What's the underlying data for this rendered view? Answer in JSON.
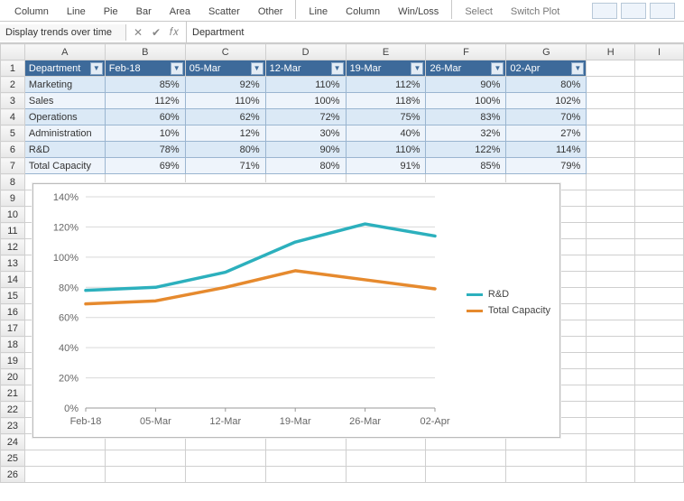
{
  "ribbon": {
    "items": [
      "Column",
      "Line",
      "Pie",
      "Bar",
      "Area",
      "Scatter",
      "Other"
    ],
    "spark": [
      "Line",
      "Column",
      "Win/Loss"
    ],
    "select": "Select",
    "switch": "Switch Plot"
  },
  "namebox": {
    "text": "Display trends over time"
  },
  "formula_label": "𝑓𝑥",
  "formula": "Department",
  "columns": [
    "A",
    "B",
    "C",
    "D",
    "E",
    "F",
    "G",
    "H",
    "I"
  ],
  "rows_shown": 26,
  "table": {
    "headers": [
      "Department",
      "Feb-18",
      "05-Mar",
      "12-Mar",
      "19-Mar",
      "26-Mar",
      "02-Apr"
    ],
    "rows": [
      {
        "dept": "Marketing",
        "vals": [
          "85%",
          "92%",
          "110%",
          "112%",
          "90%",
          "80%"
        ]
      },
      {
        "dept": "Sales",
        "vals": [
          "112%",
          "110%",
          "100%",
          "118%",
          "100%",
          "102%"
        ]
      },
      {
        "dept": "Operations",
        "vals": [
          "60%",
          "62%",
          "72%",
          "75%",
          "83%",
          "70%"
        ]
      },
      {
        "dept": "Administration",
        "vals": [
          "10%",
          "12%",
          "30%",
          "40%",
          "32%",
          "27%"
        ]
      },
      {
        "dept": "R&D",
        "vals": [
          "78%",
          "80%",
          "90%",
          "110%",
          "122%",
          "114%"
        ]
      },
      {
        "dept": "Total Capacity",
        "vals": [
          "69%",
          "71%",
          "80%",
          "91%",
          "85%",
          "79%"
        ]
      }
    ]
  },
  "chart_data": {
    "type": "line",
    "categories": [
      "Feb-18",
      "05-Mar",
      "12-Mar",
      "19-Mar",
      "26-Mar",
      "02-Apr"
    ],
    "series": [
      {
        "name": "R&D",
        "color": "#2cb0bd",
        "values": [
          78,
          80,
          90,
          110,
          122,
          114
        ]
      },
      {
        "name": "Total Capacity",
        "color": "#e68a2e",
        "values": [
          69,
          71,
          80,
          91,
          85,
          79
        ]
      }
    ],
    "yticks": [
      0,
      20,
      40,
      60,
      80,
      100,
      120,
      140
    ],
    "ylim": [
      0,
      140
    ]
  }
}
